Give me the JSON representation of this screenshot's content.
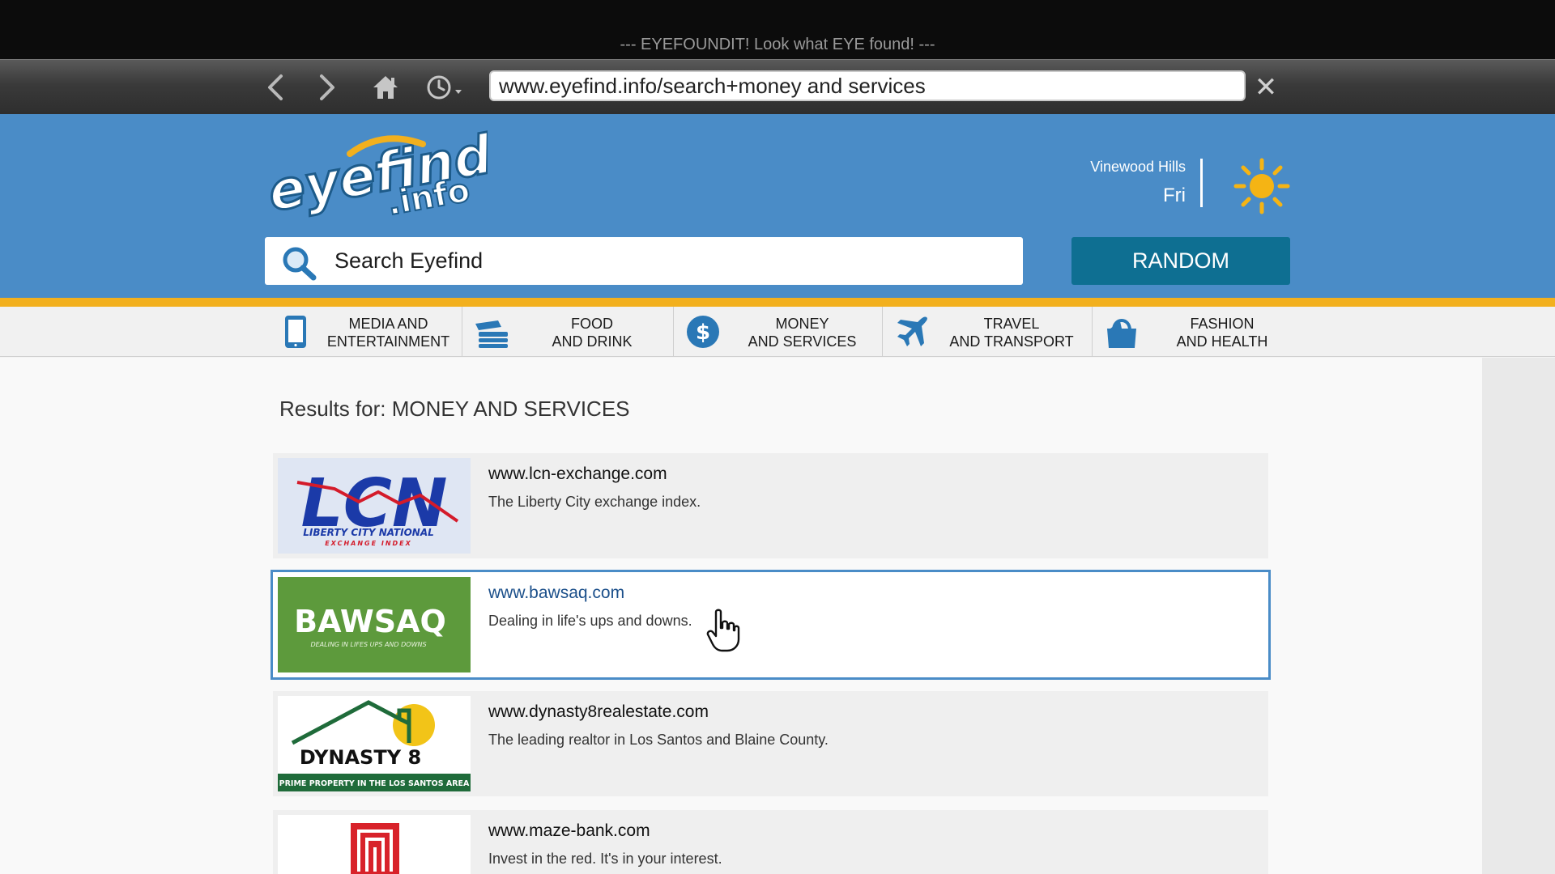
{
  "title_bar": {
    "text": "--- EYEFOUNDIT! Look what EYE found! ---"
  },
  "toolbar": {
    "url": "www.eyefind.info/search+money and services"
  },
  "logo": {
    "text_main": "eyefind",
    "text_sub": ".info"
  },
  "header": {
    "location": "Vinewood Hills",
    "day": "Fri",
    "search_placeholder": "Search Eyefind",
    "random_label": "RANDOM"
  },
  "categories": [
    {
      "line1": "MEDIA AND",
      "line2": "ENTERTAINMENT",
      "icon": "tablet-icon"
    },
    {
      "line1": "FOOD",
      "line2": "AND DRINK",
      "icon": "burger-icon"
    },
    {
      "line1": "MONEY",
      "line2": "AND SERVICES",
      "icon": "dollar-icon"
    },
    {
      "line1": "TRAVEL",
      "line2": "AND TRANSPORT",
      "icon": "airplane-icon"
    },
    {
      "line1": "FASHION",
      "line2": "AND HEALTH",
      "icon": "shopping-bag-icon"
    }
  ],
  "results_title": "Results for: MONEY AND SERVICES",
  "results": [
    {
      "url": "www.lcn-exchange.com",
      "desc": "The Liberty City exchange index.",
      "logo_main": "LCN",
      "logo_sub1": "LIBERTY CITY NATIONAL",
      "logo_sub2": "EXCHANGE INDEX"
    },
    {
      "url": "www.bawsaq.com",
      "desc": "Dealing in life's ups and downs.",
      "logo_main": "BAWSAQ",
      "logo_sub1": "DEALING IN LIFES UPS AND DOWNS"
    },
    {
      "url": "www.dynasty8realestate.com",
      "desc": "The leading realtor in Los Santos and Blaine County.",
      "logo_main": "DYNASTY 8",
      "logo_sub1": "PRIME PROPERTY IN THE LOS SANTOS AREA"
    },
    {
      "url": "www.maze-bank.com",
      "desc": "Invest in the red. It's in your interest."
    }
  ],
  "colors": {
    "header_blue": "#4a8cc7",
    "accent_gold": "#f2b01e",
    "random_button": "#0e6f92",
    "bawsaq_green": "#5d9a3c",
    "maze_red": "#d8222a"
  }
}
